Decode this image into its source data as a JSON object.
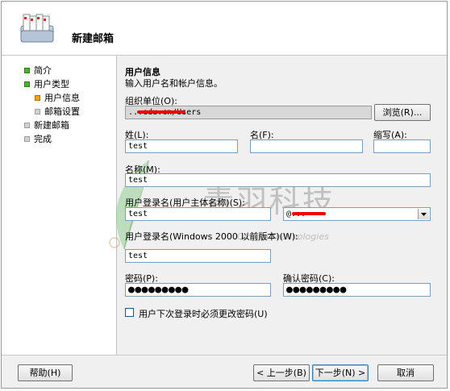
{
  "header": {
    "title": "新建邮箱"
  },
  "nav": {
    "items": [
      {
        "label": "简介",
        "state": "green"
      },
      {
        "label": "用户类型",
        "state": "green"
      },
      {
        "label": "用户信息",
        "state": "orange"
      },
      {
        "label": "邮箱设置",
        "state": "gray"
      },
      {
        "label": "新建邮箱",
        "state": "gray"
      },
      {
        "label": "完成",
        "state": "gray"
      }
    ]
  },
  "form": {
    "section_title": "用户信息",
    "section_desc": "输入用户名和帐户信息。",
    "org_unit_label": "组织单位(O):",
    "org_unit_value": "...edu.cn/Users",
    "browse_label": "浏览(R)...",
    "first_name_label": "姓(L):",
    "first_name_value": "test",
    "initials_label": "名(F):",
    "initials_value": "",
    "abbr_label": "缩写(A):",
    "abbr_value": "",
    "name_label": "名称(M):",
    "name_value": "test",
    "upn_label": "用户登录名(用户主体名称)(S):",
    "upn_value": "test",
    "upn_domain_value": "@...",
    "pre2000_label": "用户登录名(Windows 2000 以前版本)(W):",
    "pre2000_value": "test",
    "password_label": "密码(P):",
    "password_value": "●●●●●●●●●",
    "confirm_label": "确认密码(C):",
    "confirm_value": "●●●●●●●●●",
    "must_change_label": "用户下次登录时必须更改密码(U)"
  },
  "footer": {
    "help_label": "帮助(H)",
    "back_label": "< 上一步(B)",
    "next_label": "下一步(N) >",
    "cancel_label": "取消"
  },
  "watermark": {
    "cn": "青羽科技",
    "en": "Qingyu Technologies"
  },
  "colors": {
    "accent": "#3c7fb1",
    "done": "#4caf2e",
    "current": "#f5a300",
    "pending": "#d0d0d0"
  }
}
